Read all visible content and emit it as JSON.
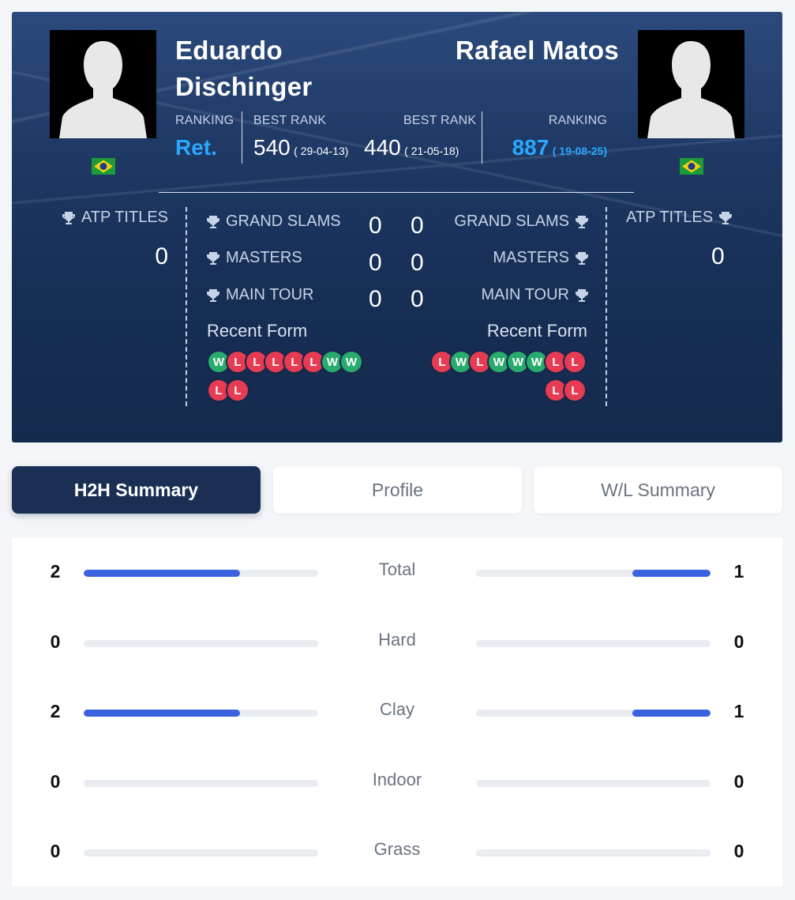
{
  "player1": {
    "name_line1": "Eduardo",
    "name_line2": "Dischinger",
    "flag": "brazil-flag",
    "ranking_label": "RANKING",
    "ranking": "Ret.",
    "best_rank_label": "BEST RANK",
    "best_rank": "540",
    "best_rank_date": "( 29-04-13)",
    "atp_titles_label": "ATP TITLES",
    "atp_titles": "0",
    "grand_slams_label": "GRAND SLAMS",
    "grand_slams": "0",
    "masters_label": "MASTERS",
    "masters": "0",
    "main_tour_label": "MAIN TOUR",
    "main_tour": "0",
    "recent_form_label": "Recent Form",
    "recent_form": [
      "W",
      "L",
      "L",
      "L",
      "L",
      "L",
      "W",
      "W",
      "L",
      "L"
    ]
  },
  "player2": {
    "name": "Rafael Matos",
    "flag": "brazil-flag",
    "ranking_label": "RANKING",
    "ranking": "887",
    "ranking_date": "( 19-08-25)",
    "best_rank_label": "BEST RANK",
    "best_rank": "440",
    "best_rank_date": "( 21-05-18)",
    "atp_titles_label": "ATP TITLES",
    "atp_titles": "0",
    "grand_slams_label": "GRAND SLAMS",
    "grand_slams": "0",
    "masters_label": "MASTERS",
    "masters": "0",
    "main_tour_label": "MAIN TOUR",
    "main_tour": "0",
    "recent_form_label": "Recent Form",
    "recent_form": [
      "L",
      "W",
      "L",
      "W",
      "W",
      "W",
      "L",
      "L",
      "L",
      "L"
    ]
  },
  "tabs": [
    {
      "label": "H2H Summary",
      "active": true
    },
    {
      "label": "Profile",
      "active": false
    },
    {
      "label": "W/L Summary",
      "active": false
    }
  ],
  "h2h": [
    {
      "label": "Total",
      "p1": "2",
      "p2": "1",
      "p1_fraction": 0.667,
      "p2_fraction": 0.333
    },
    {
      "label": "Hard",
      "p1": "0",
      "p2": "0",
      "p1_fraction": 0,
      "p2_fraction": 0
    },
    {
      "label": "Clay",
      "p1": "2",
      "p2": "1",
      "p1_fraction": 0.667,
      "p2_fraction": 0.333
    },
    {
      "label": "Indoor",
      "p1": "0",
      "p2": "0",
      "p1_fraction": 0,
      "p2_fraction": 0
    },
    {
      "label": "Grass",
      "p1": "0",
      "p2": "0",
      "p1_fraction": 0,
      "p2_fraction": 0
    }
  ],
  "colors": {
    "accent_blue": "#29a8ff",
    "bar_blue": "#3b63e0",
    "win_green": "#2aab6e",
    "loss_red": "#e63b52",
    "hero_navy": "#1b2f55"
  }
}
